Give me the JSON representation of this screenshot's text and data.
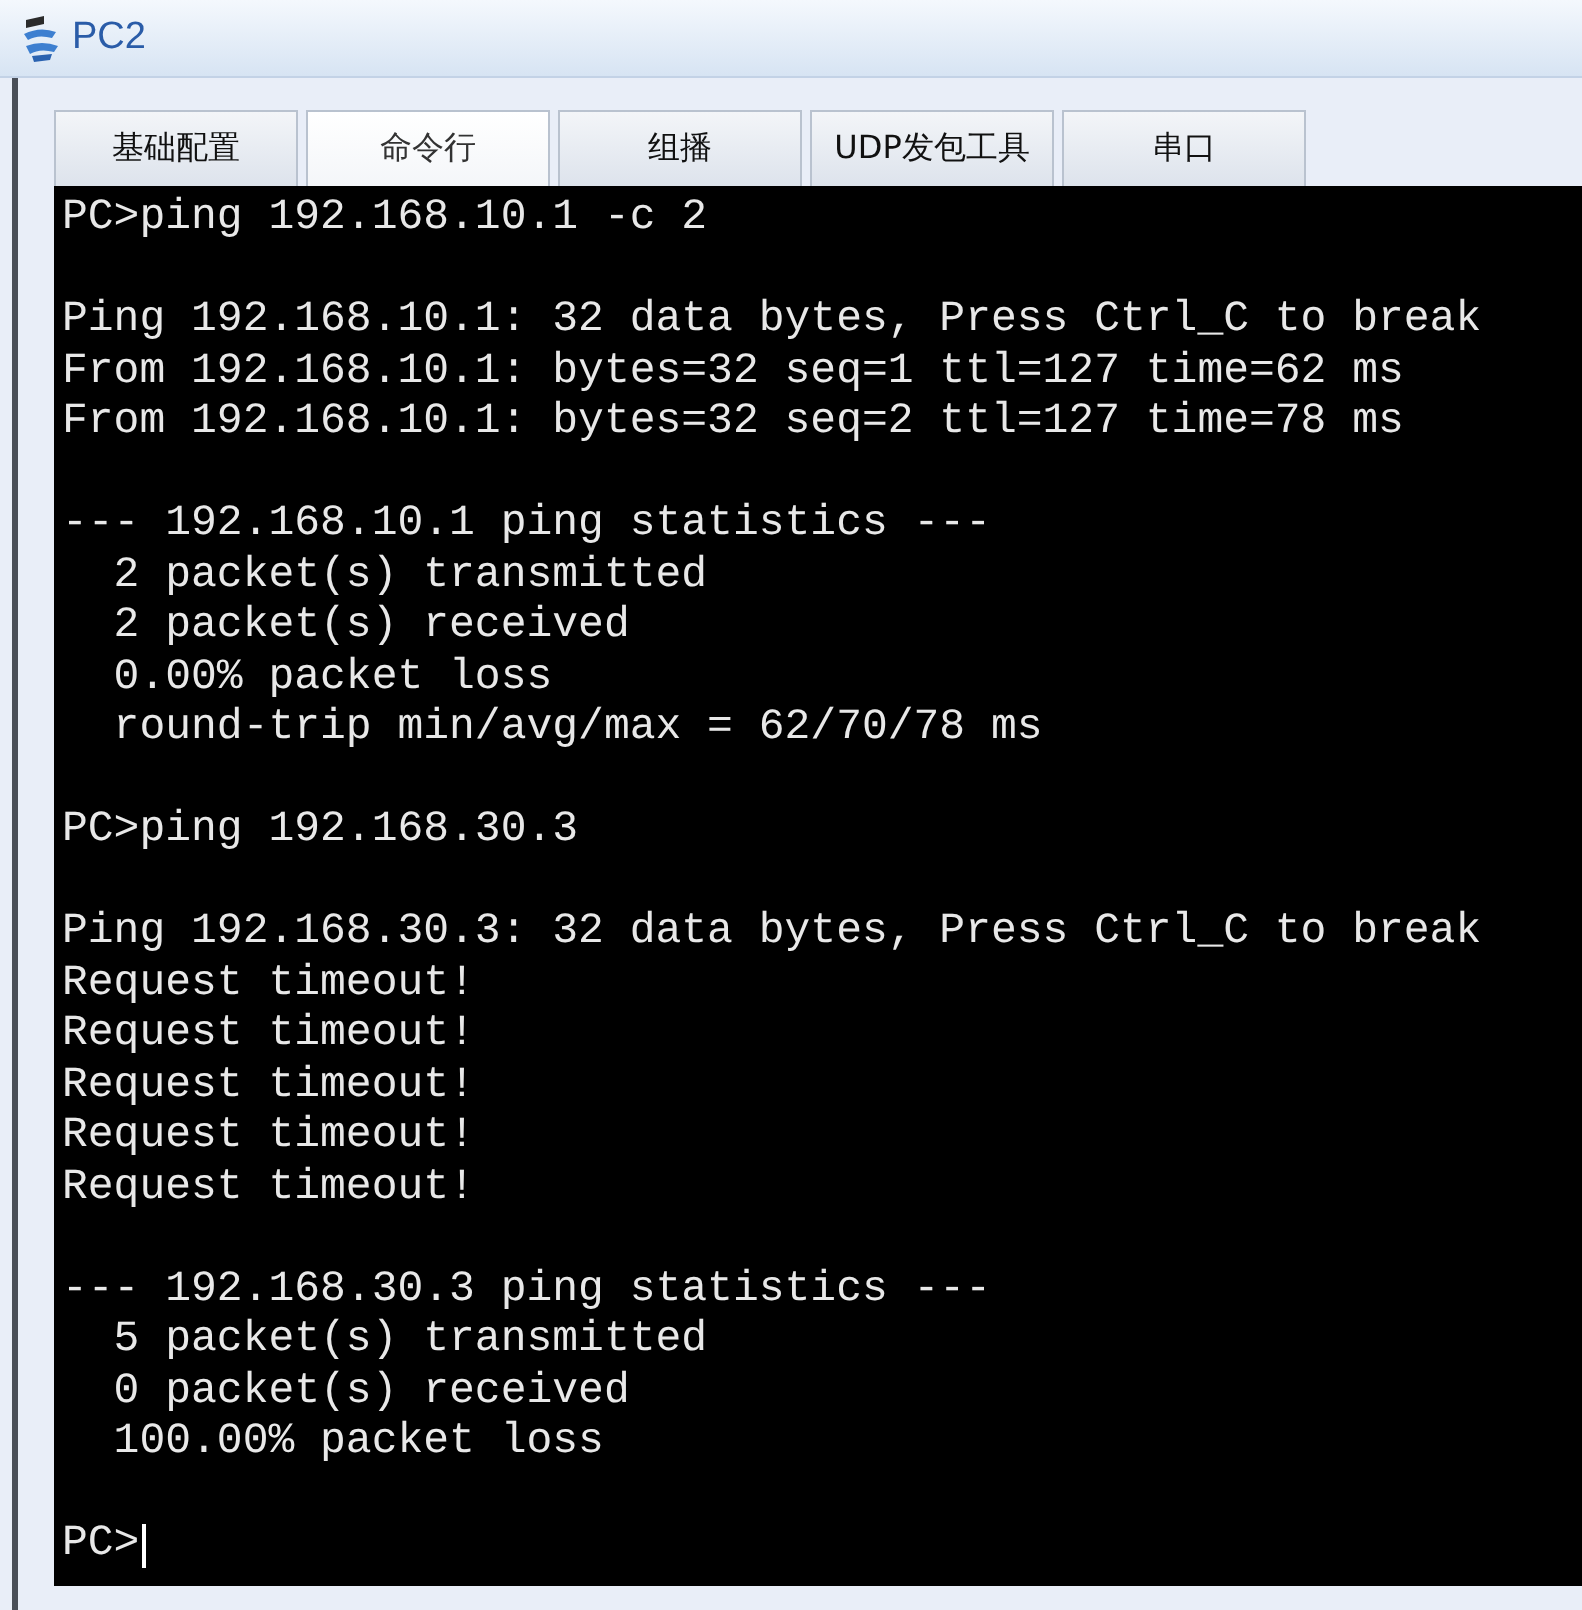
{
  "window": {
    "title": "PC2"
  },
  "tabs": [
    {
      "label": "基础配置",
      "selected": false
    },
    {
      "label": "命令行",
      "selected": true
    },
    {
      "label": "组播",
      "selected": false
    },
    {
      "label": "UDP发包工具",
      "selected": false
    },
    {
      "label": "串口",
      "selected": false
    }
  ],
  "terminal": {
    "lines": [
      {
        "text": "PC>ping 192.168.10.1 -c 2",
        "blank_before": false,
        "cursor": false
      },
      {
        "text": "Ping 192.168.10.1: 32 data bytes, Press Ctrl_C to break",
        "blank_before": true,
        "cursor": false
      },
      {
        "text": "From 192.168.10.1: bytes=32 seq=1 ttl=127 time=62 ms",
        "blank_before": false,
        "cursor": false
      },
      {
        "text": "From 192.168.10.1: bytes=32 seq=2 ttl=127 time=78 ms",
        "blank_before": false,
        "cursor": false
      },
      {
        "text": "--- 192.168.10.1 ping statistics ---",
        "blank_before": true,
        "cursor": false
      },
      {
        "text": "  2 packet(s) transmitted",
        "blank_before": false,
        "cursor": false
      },
      {
        "text": "  2 packet(s) received",
        "blank_before": false,
        "cursor": false
      },
      {
        "text": "  0.00% packet loss",
        "blank_before": false,
        "cursor": false
      },
      {
        "text": "  round-trip min/avg/max = 62/70/78 ms",
        "blank_before": false,
        "cursor": false
      },
      {
        "text": "PC>ping 192.168.30.3",
        "blank_before": true,
        "cursor": false
      },
      {
        "text": "Ping 192.168.30.3: 32 data bytes, Press Ctrl_C to break",
        "blank_before": true,
        "cursor": false
      },
      {
        "text": "Request timeout!",
        "blank_before": false,
        "cursor": false
      },
      {
        "text": "Request timeout!",
        "blank_before": false,
        "cursor": false
      },
      {
        "text": "Request timeout!",
        "blank_before": false,
        "cursor": false
      },
      {
        "text": "Request timeout!",
        "blank_before": false,
        "cursor": false
      },
      {
        "text": "Request timeout!",
        "blank_before": false,
        "cursor": false
      },
      {
        "text": "--- 192.168.30.3 ping statistics ---",
        "blank_before": true,
        "cursor": false
      },
      {
        "text": "  5 packet(s) transmitted",
        "blank_before": false,
        "cursor": false
      },
      {
        "text": "  0 packet(s) received",
        "blank_before": false,
        "cursor": false
      },
      {
        "text": "  100.00% packet loss",
        "blank_before": false,
        "cursor": false
      },
      {
        "text": "PC>",
        "blank_before": true,
        "cursor": true
      }
    ]
  }
}
